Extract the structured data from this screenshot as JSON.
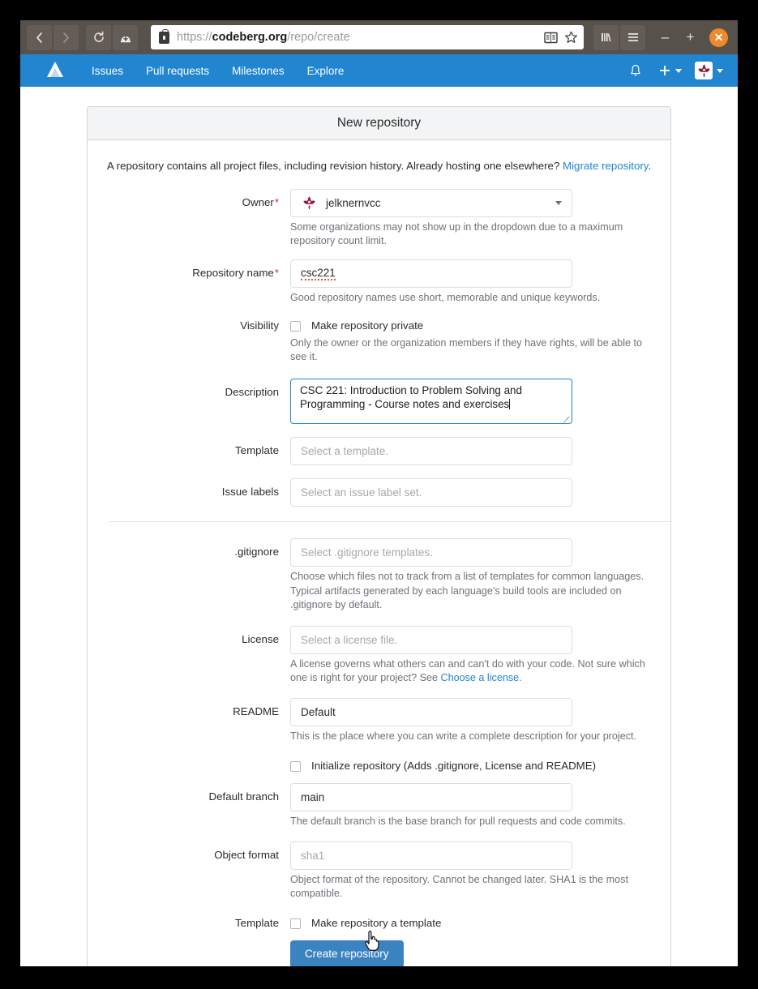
{
  "browser": {
    "nav": {
      "back": "back-arrow",
      "forward": "forward-arrow",
      "reload": "reload-icon",
      "container": "new-container-tab-icon"
    },
    "url": {
      "scheme": "https://",
      "host": "codeberg.org",
      "path": "/repo/create",
      "full": "https://codeberg.org/repo/create",
      "lock": "lock-icon",
      "reader_icon": "reader-view-icon",
      "bookmark_icon": "star-icon"
    },
    "toolbar": {
      "library_icon": "library-icon",
      "menu_icon": "hamburger-menu-icon",
      "minimize": "–",
      "maximize": "+",
      "close": "✕"
    }
  },
  "site_nav": {
    "logo": "codeberg-logo",
    "links": [
      {
        "label": "Issues"
      },
      {
        "label": "Pull requests"
      },
      {
        "label": "Milestones"
      },
      {
        "label": "Explore"
      }
    ],
    "notifications_icon": "bell-icon",
    "create_icon": "plus-icon",
    "avatar": "user-avatar"
  },
  "page": {
    "title": "New repository",
    "intro_text": "A repository contains all project files, including revision history. Already hosting one elsewhere? ",
    "intro_link": "Migrate repository",
    "intro_period": ".",
    "fields": {
      "owner": {
        "label": "Owner",
        "required": "*",
        "value": "jelknernvcc",
        "hint": "Some organizations may not show up in the dropdown due to a maximum repository count limit."
      },
      "repo_name": {
        "label": "Repository name",
        "required": "*",
        "value": "csc221",
        "hint": "Good repository names use short, memorable and unique keywords."
      },
      "visibility": {
        "label": "Visibility",
        "checkbox_label": "Make repository private",
        "checked": false,
        "hint": "Only the owner or the organization members if they have rights, will be able to see it."
      },
      "description": {
        "label": "Description",
        "value": "CSC 221: Introduction to Problem Solving and Programming - Course notes and exercises",
        "focused": true
      },
      "template_select": {
        "label": "Template",
        "placeholder": "Select a template."
      },
      "issue_labels": {
        "label": "Issue labels",
        "placeholder": "Select an issue label set."
      },
      "gitignore": {
        "label": ".gitignore",
        "placeholder": "Select .gitignore templates.",
        "hint": "Choose which files not to track from a list of templates for common languages. Typical artifacts generated by each language's build tools are included on .gitignore by default."
      },
      "license": {
        "label": "License",
        "placeholder": "Select a license file.",
        "hint_before": "A license governs what others can and can't do with your code. Not sure which one is right for your project? See ",
        "hint_link": "Choose a license",
        "hint_after": "."
      },
      "readme": {
        "label": "README",
        "value": "Default",
        "hint": "This is the place where you can write a complete description for your project."
      },
      "initialize": {
        "checkbox_label": "Initialize repository (Adds .gitignore, License and README)",
        "checked": false
      },
      "default_branch": {
        "label": "Default branch",
        "value": "main",
        "hint": "The default branch is the base branch for pull requests and code commits."
      },
      "object_format": {
        "label": "Object format",
        "placeholder": "sha1",
        "hint": "Object format of the repository. Cannot be changed later. SHA1 is the most compatible."
      },
      "is_template": {
        "label": "Template",
        "checkbox_label": "Make repository a template",
        "checked": false
      }
    },
    "submit_label": "Create repository"
  },
  "colors": {
    "brand_blue": "#2185d0",
    "button_blue": "#3b83c0",
    "chrome_brown": "#57514c",
    "close_orange": "#f0892a",
    "required_red": "#db2828",
    "avatar_maroon": "#8e1b3c"
  }
}
